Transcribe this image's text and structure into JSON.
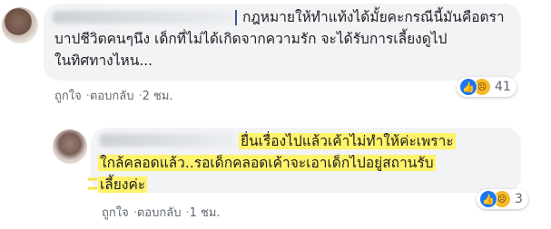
{
  "comments": [
    {
      "lines": [
        "กฎหมายให้ทำแท้งได้มั้ยคะกรณีนี้มันคือตรา",
        "บาปชีวิตคนๆนึง เด็กที่ไม่ได้เกิดจากความรัก จะได้รับการเลี้ยงดูไป",
        "ในทิศทางไหน..."
      ],
      "like_label": "ถูกใจ",
      "reply_label": "ตอบกลับ",
      "time": "2 ชม.",
      "reaction_count": "41"
    },
    {
      "lines": [
        "ยื่นเรื่องไปแล้วเค้าไม่ทำให้ค่ะเพราะ",
        "ใกล้คลอดแล้ว..รอเด็กคลอดเค้าจะเอาเด็กไปอยู่สถานรับ",
        "เลี้ยงค่ะ"
      ],
      "like_label": "ถูกใจ",
      "reply_label": "ตอบกลับ",
      "time": "1 ชม.",
      "reaction_count": "3"
    }
  ],
  "separator": "·",
  "icons": {
    "like": "thumbs-up-icon",
    "sad": "sad-face-icon"
  },
  "colors": {
    "bubble": "#f2f3f5",
    "highlight": "#fff36b",
    "like_blue": "#1877f2",
    "meta_gray": "#606770"
  }
}
